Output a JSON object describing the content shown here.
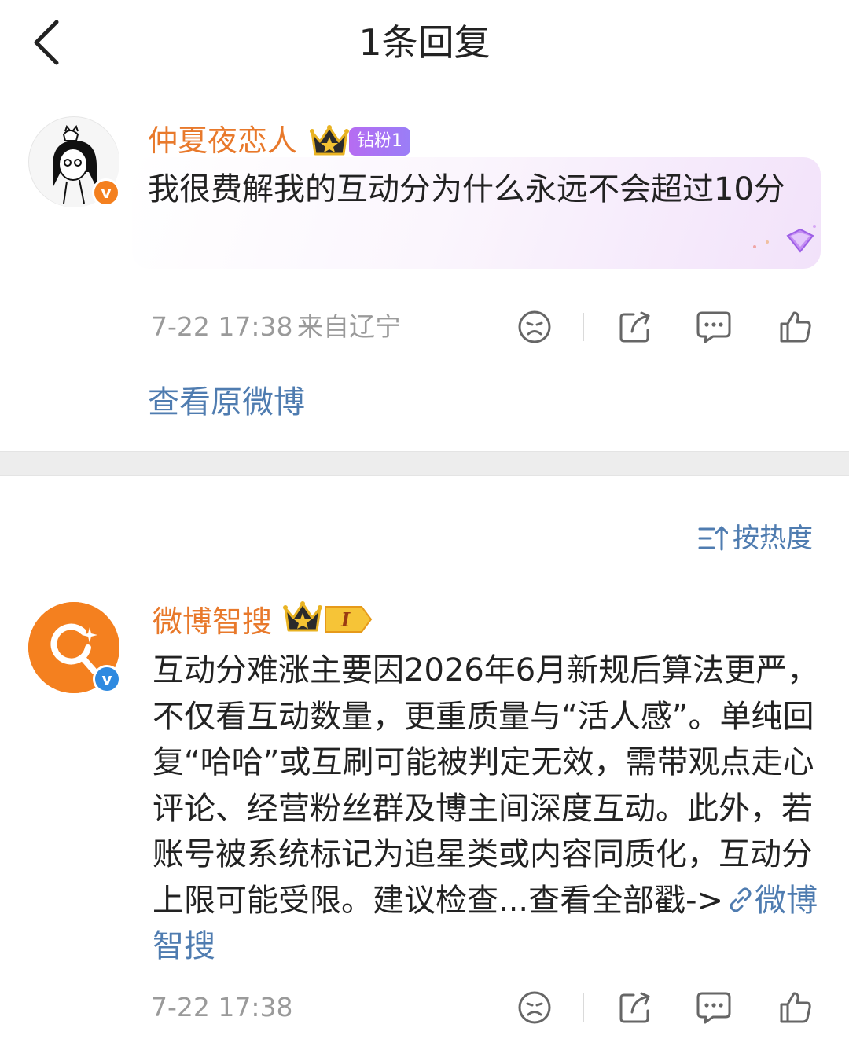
{
  "header": {
    "title": "1条回复",
    "back_icon": "chevron-left-icon"
  },
  "comment": {
    "username": "仲夏夜恋人",
    "crown_icon": "crown-icon",
    "fan_badge": "钻粉1",
    "text": "我很费解我的互动分为什么永远不会超过10分",
    "time": "7-22 17:38",
    "location": "来自辽宁",
    "view_original": "查看原微博"
  },
  "sort": {
    "label": "按热度",
    "icon": "sort-icon"
  },
  "reply": {
    "username": "微博智搜",
    "crown_badge_text": "I",
    "text": "互动分难涨主要因2026年6月新规后算法更严，不仅看互动数量，更重质量与“活人感”。单纯回复“哈哈”或互刷可能被判定无效，需带观点走心评论、经营粉丝群及博主间深度互动。此外，若账号被系统标记为追星类或内容同质化，互动分上限可能受限。建议检查...查看全部戳->",
    "link_text": "微博智搜",
    "time": "7-22 17:38"
  },
  "colors": {
    "username": "#e8792b",
    "link": "#4f7cb0",
    "meta": "#9a9a9a",
    "avatar_orange": "#f4801f",
    "badge_purple": "#b66cf2"
  },
  "icons": {
    "dislike": "sad-face-icon",
    "share": "share-icon",
    "comment": "comment-icon",
    "like": "thumbs-up-icon",
    "verified": "verified-v-icon",
    "link": "link-icon"
  }
}
